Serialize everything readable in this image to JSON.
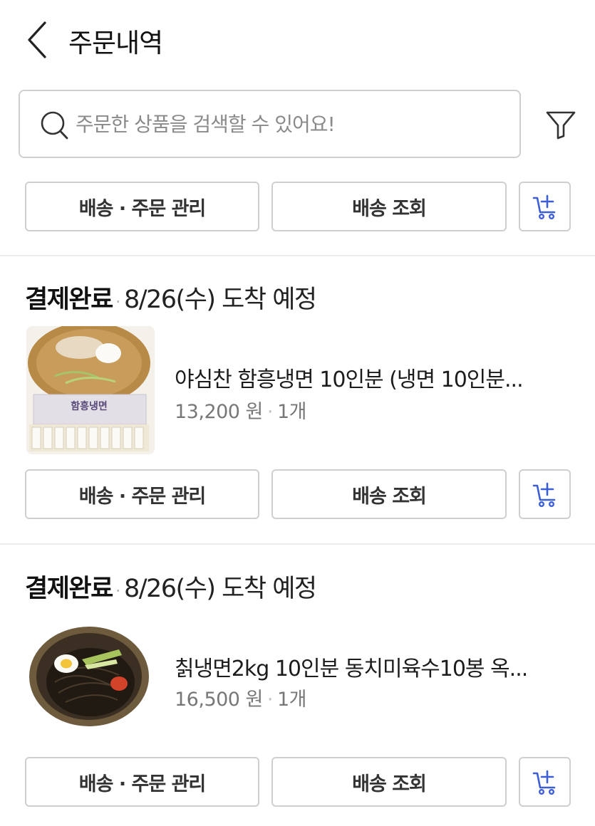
{
  "header": {
    "title": "주문내역",
    "back_icon": "chevron-left-icon"
  },
  "search": {
    "placeholder": "주문한 상품을 검색할 수 있어요!",
    "value": "",
    "icon": "search-icon"
  },
  "filter": {
    "icon": "filter-icon"
  },
  "top_actions": {
    "manage_label": "배송 · 주문 관리",
    "track_label": "배송 조회",
    "cart_icon": "add-to-cart-icon"
  },
  "colors": {
    "accent": "#3d5fd6",
    "border": "#cfcfcf",
    "divider": "#ececec",
    "muted_text": "#777777"
  },
  "orders": [
    {
      "status": "결제완료",
      "eta": "8/26(수) 도착 예정",
      "product_name": "야심찬 함흥냉면 10인분 (냉면 10인분...",
      "price": "13,200 원",
      "quantity": "1개",
      "package_text": "함흥냉면",
      "manage_label": "배송 · 주문 관리",
      "track_label": "배송 조회"
    },
    {
      "status": "결제완료",
      "eta": "8/26(수) 도착 예정",
      "product_name": "칡냉면2kg 10인분 동치미육수10봉 옥...",
      "price": "16,500 원",
      "quantity": "1개",
      "manage_label": "배송 · 주문 관리",
      "track_label": "배송 조회"
    }
  ]
}
